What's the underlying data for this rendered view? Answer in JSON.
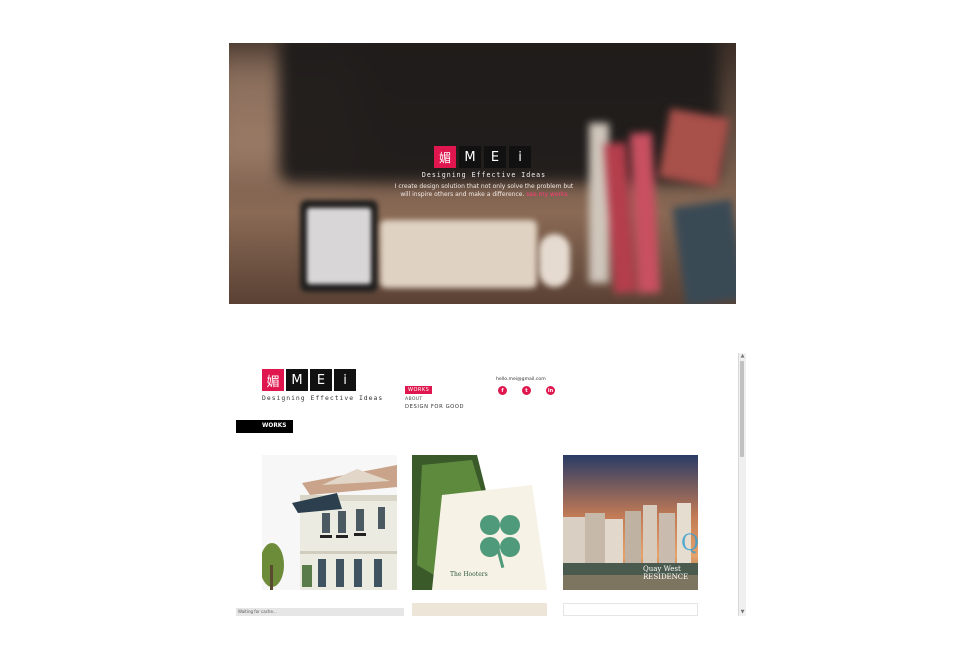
{
  "hero": {
    "logo": {
      "cells": [
        "媚",
        "M",
        "E",
        "i"
      ]
    },
    "tagline": "Designing Effective Ideas",
    "description_line1": "I create design solution that not only solve the problem but",
    "description_line2": "will inspire others and make a difference.",
    "description_link": "see my works"
  },
  "site": {
    "logo": {
      "cells": [
        "媚",
        "M",
        "E",
        "i"
      ]
    },
    "tagline": "Designing Effective Ideas",
    "nav": {
      "active": "WORKS",
      "items": [
        "ABOUT",
        "DESIGN FOR GOOD"
      ]
    },
    "contact": {
      "email": "hello.mei@gmail.com",
      "social": [
        "f",
        "t",
        "in"
      ]
    },
    "section_title": "WORKS",
    "statusbar": "Waiting for cache..."
  },
  "colors": {
    "accent": "#e0174f",
    "black": "#111111"
  },
  "tiles": [
    {
      "name": "heritage-building",
      "caption": ""
    },
    {
      "name": "the-hooters-branding",
      "caption": "The Hooters"
    },
    {
      "name": "quay-west-residence",
      "caption": "Quay West RESIDENCE"
    }
  ]
}
